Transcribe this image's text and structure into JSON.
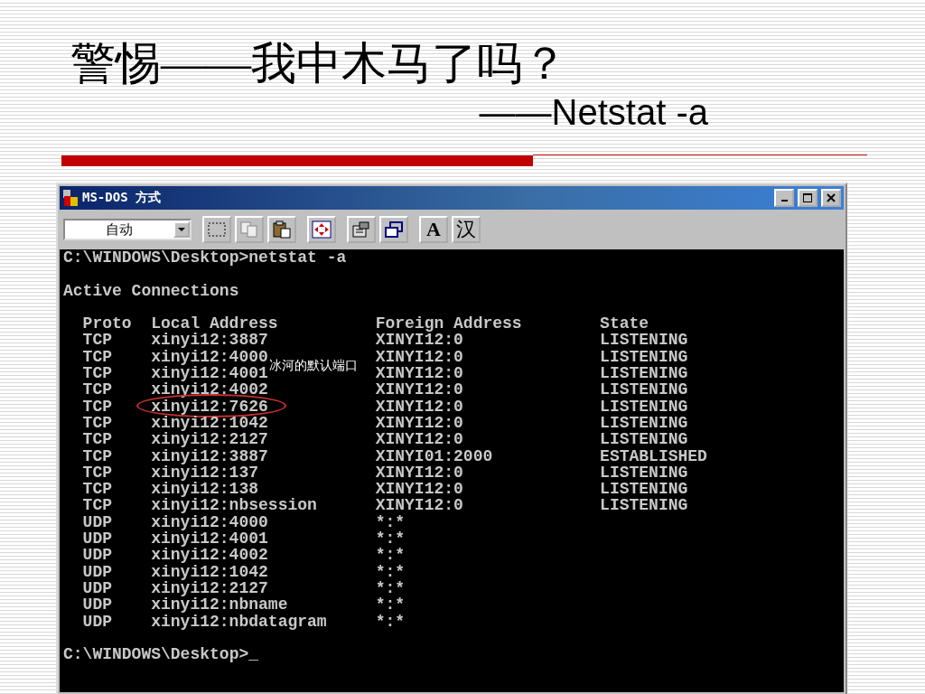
{
  "slide": {
    "title": "警惕——我中木马了吗？",
    "subtitle": "——Netstat -a"
  },
  "window": {
    "title": "MS-DOS 方式"
  },
  "toolbar": {
    "font_dropdown": {
      "value": "自动"
    },
    "buttons": [
      {
        "kind": "mark"
      },
      {
        "kind": "copy"
      },
      {
        "kind": "paste"
      },
      {
        "kind": "fullscreen"
      },
      {
        "kind": "properties"
      },
      {
        "kind": "background"
      },
      {
        "kind": "font",
        "label": "A"
      },
      {
        "kind": "ime",
        "label": "汉"
      }
    ]
  },
  "console": {
    "command": "C:\\WINDOWS\\Desktop>netstat -a",
    "heading": "Active Connections",
    "columns": [
      "Proto",
      "Local Address",
      "Foreign Address",
      "State"
    ],
    "rows": [
      {
        "proto": "TCP",
        "local": "xinyi12:3887",
        "foreign": "XINYI12:0",
        "state": "LISTENING",
        "highlighted": false
      },
      {
        "proto": "TCP",
        "local": "xinyi12:4000",
        "foreign": "XINYI12:0",
        "state": "LISTENING",
        "highlighted": false
      },
      {
        "proto": "TCP",
        "local": "xinyi12:4001",
        "foreign": "XINYI12:0",
        "state": "LISTENING",
        "highlighted": false
      },
      {
        "proto": "TCP",
        "local": "xinyi12:4002",
        "foreign": "XINYI12:0",
        "state": "LISTENING",
        "highlighted": false
      },
      {
        "proto": "TCP",
        "local": "xinyi12:7626",
        "foreign": "XINYI12:0",
        "state": "LISTENING",
        "highlighted": true
      },
      {
        "proto": "TCP",
        "local": "xinyi12:1042",
        "foreign": "XINYI12:0",
        "state": "LISTENING",
        "highlighted": false
      },
      {
        "proto": "TCP",
        "local": "xinyi12:2127",
        "foreign": "XINYI12:0",
        "state": "LISTENING",
        "highlighted": false
      },
      {
        "proto": "TCP",
        "local": "xinyi12:3887",
        "foreign": "XINYI01:2000",
        "state": "ESTABLISHED",
        "highlighted": false
      },
      {
        "proto": "TCP",
        "local": "xinyi12:137",
        "foreign": "XINYI12:0",
        "state": "LISTENING",
        "highlighted": false
      },
      {
        "proto": "TCP",
        "local": "xinyi12:138",
        "foreign": "XINYI12:0",
        "state": "LISTENING",
        "highlighted": false
      },
      {
        "proto": "TCP",
        "local": "xinyi12:nbsession",
        "foreign": "XINYI12:0",
        "state": "LISTENING",
        "highlighted": false
      },
      {
        "proto": "UDP",
        "local": "xinyi12:4000",
        "foreign": "*:*",
        "highlighted": false
      },
      {
        "proto": "UDP",
        "local": "xinyi12:4001",
        "foreign": "*:*",
        "highlighted": false
      },
      {
        "proto": "UDP",
        "local": "xinyi12:4002",
        "foreign": "*:*",
        "highlighted": false
      },
      {
        "proto": "UDP",
        "local": "xinyi12:1042",
        "foreign": "*:*",
        "highlighted": false
      },
      {
        "proto": "UDP",
        "local": "xinyi12:2127",
        "foreign": "*:*",
        "highlighted": false
      },
      {
        "proto": "UDP",
        "local": "xinyi12:nbname",
        "foreign": "*:*",
        "highlighted": false
      },
      {
        "proto": "UDP",
        "local": "xinyi12:nbdatagram",
        "foreign": "*:*",
        "highlighted": false
      }
    ],
    "prompt": "C:\\WINDOWS\\Desktop>_",
    "annotation": "冰河的默认端口"
  }
}
